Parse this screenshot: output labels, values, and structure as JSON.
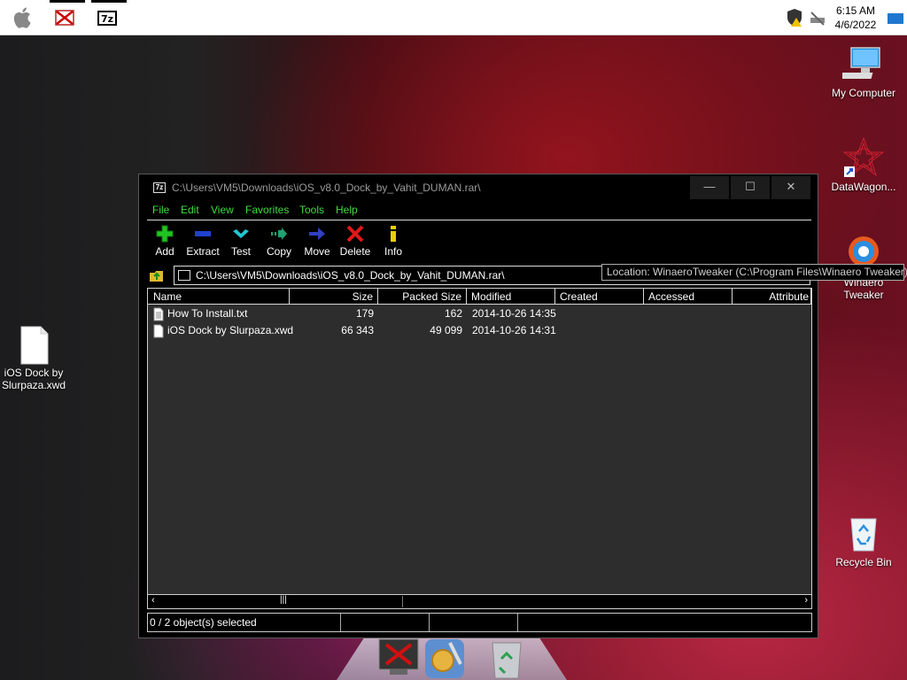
{
  "topbar": {
    "clock_time": "6:15 AM",
    "clock_date": "4/6/2022"
  },
  "desktop": {
    "icons": [
      {
        "label": "My Computer"
      },
      {
        "label": "DataWagon..."
      },
      {
        "label": "Winaero Tweaker"
      },
      {
        "label": "Recycle Bin"
      },
      {
        "label": "iOS Dock by Slurpaza.xwd"
      }
    ]
  },
  "window": {
    "title": "C:\\Users\\VM5\\Downloads\\iOS_v8.0_Dock_by_Vahit_DUMAN.rar\\",
    "title_icon": "7z",
    "controls": {
      "minimize": "—",
      "maximize": "☐",
      "close": "✕"
    },
    "menu": [
      "File",
      "Edit",
      "View",
      "Favorites",
      "Tools",
      "Help"
    ],
    "toolbar": [
      {
        "label": "Add",
        "icon": "add-icon"
      },
      {
        "label": "Extract",
        "icon": "extract-icon"
      },
      {
        "label": "Test",
        "icon": "test-icon"
      },
      {
        "label": "Copy",
        "icon": "copy-icon"
      },
      {
        "label": "Move",
        "icon": "move-icon"
      },
      {
        "label": "Delete",
        "icon": "delete-icon"
      },
      {
        "label": "Info",
        "icon": "info-icon"
      }
    ],
    "address": "C:\\Users\\VM5\\Downloads\\iOS_v8.0_Dock_by_Vahit_DUMAN.rar\\",
    "columns": [
      "Name",
      "Size",
      "Packed Size",
      "Modified",
      "Created",
      "Accessed",
      "Attribute"
    ],
    "rows": [
      {
        "name": "How To Install.txt",
        "size": "179",
        "packed": "162",
        "modified": "2014-10-26 14:35"
      },
      {
        "name": "iOS Dock by Slurpaza.xwd",
        "size": "66 343",
        "packed": "49 099",
        "modified": "2014-10-26 14:31"
      }
    ],
    "status": "0 / 2 object(s) selected"
  },
  "tooltip": "Location: WinaeroTweaker (C:\\Program Files\\Winaero Tweaker)",
  "colors": {
    "menu_green": "#3fdc3f",
    "window_bg": "#000000",
    "list_bg": "#2d2d2d"
  }
}
